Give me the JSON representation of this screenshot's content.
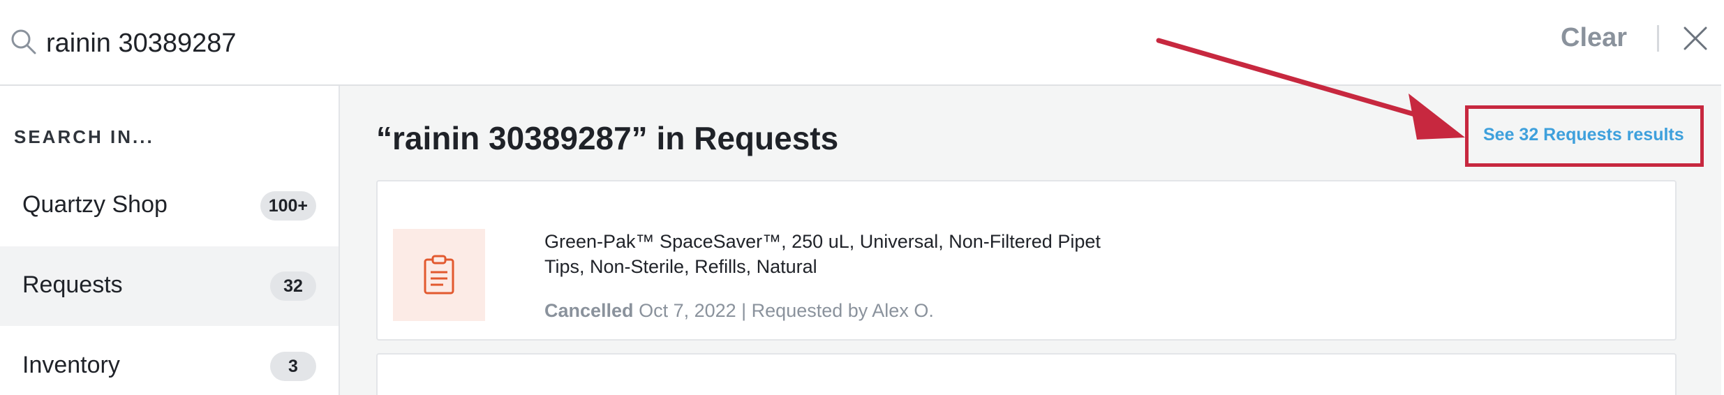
{
  "search": {
    "value": "rainin 30389287",
    "clear_label": "Clear"
  },
  "sidebar": {
    "title": "SEARCH IN...",
    "items": [
      {
        "label": "Quartzy Shop",
        "count": "100+"
      },
      {
        "label": "Requests",
        "count": "32"
      },
      {
        "label": "Inventory",
        "count": "3"
      }
    ]
  },
  "main": {
    "heading": "“rainin 30389287” in Requests",
    "see_all_label": "See 32 Requests results",
    "results": [
      {
        "title": "Green-Pak™ SpaceSaver™, 250 uL, Universal, Non-Filtered Pipet Tips, Non-Sterile, Refills, Natural",
        "status": "Cancelled",
        "details": " Oct 7, 2022 | Requested by Alex O."
      }
    ]
  },
  "colors": {
    "link": "#3ea0dc",
    "annotation": "#c7283f",
    "thumb_bg": "#fcebe6",
    "thumb_icon": "#e2592f"
  }
}
